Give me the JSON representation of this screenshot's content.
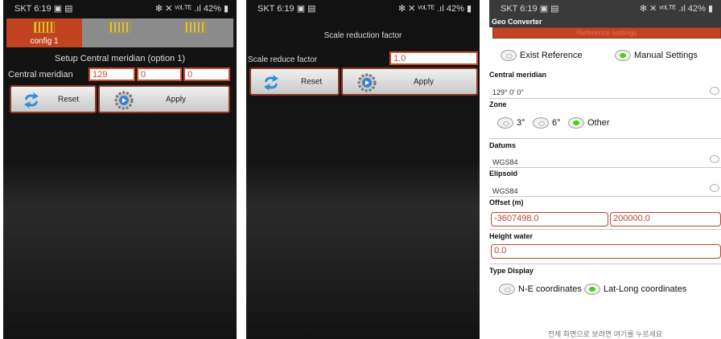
{
  "status_bar": {
    "left": "SKT 6:19 ▣ ▤",
    "right": "✻ ✕ ᵛᵒᴸᵀᴱ .ıl 42% ▮"
  },
  "screen1": {
    "tabs": [
      {
        "label": "config 1",
        "active": true
      },
      {
        "label": "",
        "active": false
      },
      {
        "label": "",
        "active": false
      }
    ],
    "title": "Setup Central meridian (option 1)",
    "central_meridian_label": "Central meridian",
    "meridian_values": [
      "129",
      "0",
      "0"
    ],
    "reset_label": "Reset",
    "apply_label": "Apply"
  },
  "screen2": {
    "title": "Scale reduction factor",
    "field_label": "Scale reduce factor",
    "field_value": "1.0",
    "reset_label": "Reset",
    "apply_label": "Apply"
  },
  "screen3": {
    "app_title": "Geo Converter",
    "reference_bar": "Reference settings",
    "reference_options": [
      {
        "label": "Exist Reference",
        "selected": false
      },
      {
        "label": "Manual Settings",
        "selected": true
      }
    ],
    "central_meridian_title": "Central meridian",
    "central_meridian_value": "129° 0' 0\"",
    "zone_title": "Zone",
    "zone_options": [
      {
        "label": "3°",
        "selected": false
      },
      {
        "label": "6°",
        "selected": false
      },
      {
        "label": "Other",
        "selected": true
      }
    ],
    "datums_title": "Datums",
    "datums_value": "WGS84",
    "ellipsoid_title": "Elipsoid",
    "ellipsoid_value": "WGS84",
    "offset_title": "Offset (m)",
    "offset_values": [
      "-3607498.0",
      "200000.0"
    ],
    "height_title": "Height water",
    "height_value": "0.0",
    "type_display_title": "Type Display",
    "type_display_options": [
      {
        "label": "N-E coordinates",
        "selected": false
      },
      {
        "label": "Lat-Long coordinates",
        "selected": true
      }
    ],
    "footer": "전체 화면으로 보려면 여기를 누르세요"
  },
  "colors": {
    "accent": "#c24322",
    "tab_inactive": "#8c8c8c",
    "radio_on": "#48d010",
    "field_border": "#c94a2b"
  }
}
